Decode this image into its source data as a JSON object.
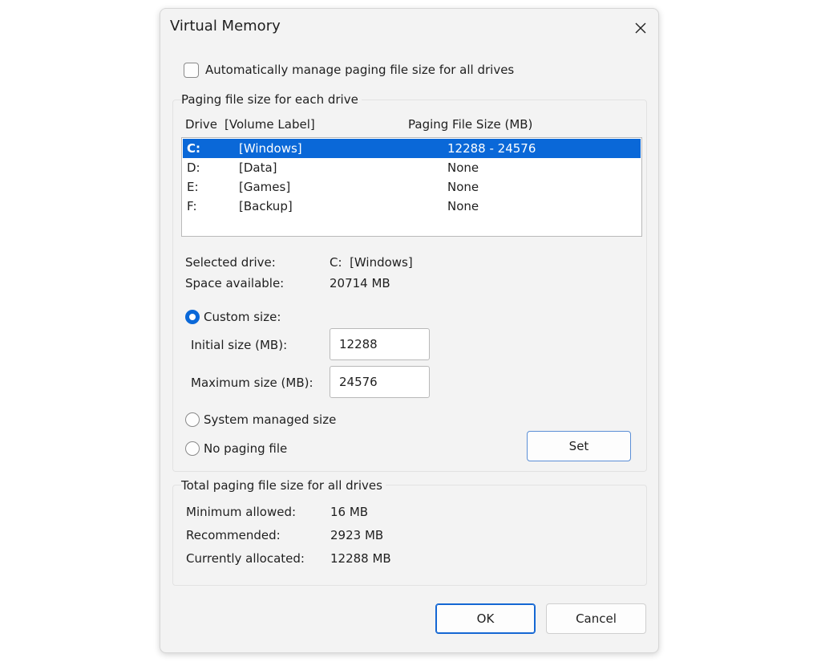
{
  "dialog": {
    "title": "Virtual Memory",
    "close_icon": "close-icon"
  },
  "auto_manage": {
    "label": "Automatically manage paging file size for all drives",
    "checked": false
  },
  "drive_group": {
    "title": "Paging file size for each drive",
    "columns": {
      "drive": "Drive",
      "volume_label": "[Volume Label]",
      "size": "Paging File Size (MB)"
    },
    "drives": [
      {
        "drive": "C:",
        "label": "[Windows]",
        "size": "12288 - 24576",
        "selected": true
      },
      {
        "drive": "D:",
        "label": "[Data]",
        "size": "None",
        "selected": false
      },
      {
        "drive": "E:",
        "label": "[Games]",
        "size": "None",
        "selected": false
      },
      {
        "drive": "F:",
        "label": "[Backup]",
        "size": "None",
        "selected": false
      }
    ],
    "selected_drive_label": "Selected drive:",
    "selected_drive_value": "C:  [Windows]",
    "space_available_label": "Space available:",
    "space_available_value": "20714 MB",
    "custom_size_label": "Custom size:",
    "initial_size_label": "Initial size (MB):",
    "initial_size_value": "12288",
    "maximum_size_label": "Maximum size (MB):",
    "maximum_size_value": "24576",
    "system_managed_label": "System managed size",
    "no_paging_label": "No paging file",
    "selected_option": "custom",
    "set_label": "Set"
  },
  "total_group": {
    "title": "Total paging file size for all drives",
    "minimum_label": "Minimum allowed:",
    "minimum_value": "16 MB",
    "recommended_label": "Recommended:",
    "recommended_value": "2923 MB",
    "allocated_label": "Currently allocated:",
    "allocated_value": "12288 MB"
  },
  "buttons": {
    "ok_label": "OK",
    "cancel_label": "Cancel"
  },
  "colors": {
    "accent": "#0a68d8",
    "dialog_background": "#f3f3f3"
  }
}
